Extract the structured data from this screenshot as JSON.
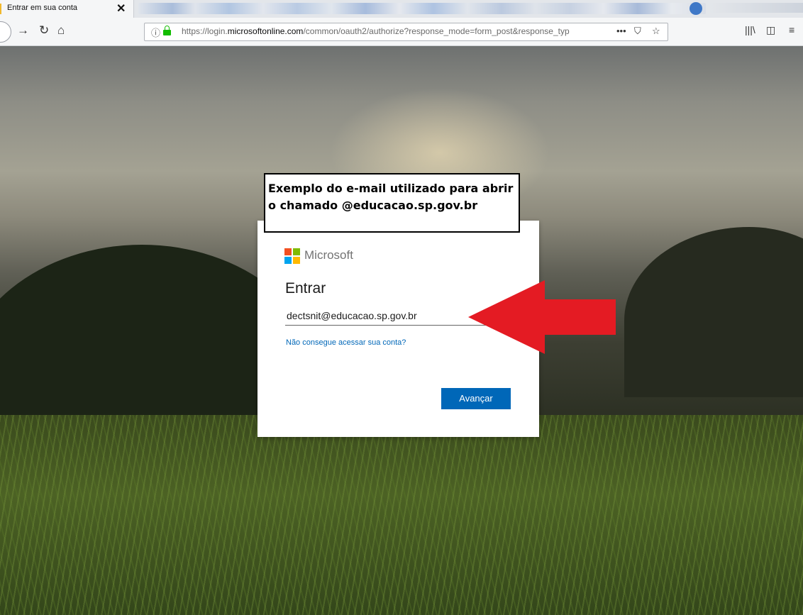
{
  "browser": {
    "tab_title": "Entrar em sua conta",
    "tab_close": "✕",
    "url_prefix": "https://login.",
    "url_domain": "microsoftonline.com",
    "url_path": "/common/oauth2/authorize?response_mode=form_post&response_typ",
    "url_more": "•••"
  },
  "login": {
    "brand": "Microsoft",
    "title": "Entrar",
    "email_value": "dectsnit@educacao.sp.gov.br",
    "help_link": "Não consegue acessar sua conta?",
    "next_label": "Avançar"
  },
  "annotation": {
    "line1": "Exemplo do e-mail utilizado para abrir",
    "line2": "o chamado @educacao.sp.gov.br"
  },
  "colors": {
    "accent": "#0067b8",
    "arrow": "#e41b23"
  }
}
